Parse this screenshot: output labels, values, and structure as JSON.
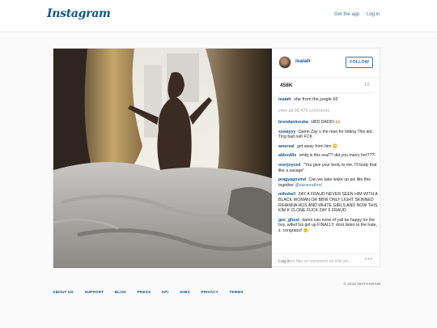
{
  "header": {
    "logo": "Instagram",
    "get_app": "Get the app",
    "login": "Log in"
  },
  "post": {
    "username": "isaiah",
    "follow_label": "FOLLOW",
    "likes": "458K",
    "age": "1d",
    "caption_user": "isaiah",
    "caption_text": "she from the jungle 66",
    "view_all": "view all 38,479 comments",
    "comments": [
      {
        "user": "brendaninoska",
        "text": "HBD DADDI 🙌🏼"
      },
      {
        "user": "sswayyy",
        "text": "Damn Zay u the man for hitting This kid.. Ting bad nah FCK"
      },
      {
        "user": "amereal",
        "text": "get away from him 😳"
      },
      {
        "user": "abbsville",
        "text": "omfg is this real?? did you marry her???!"
      },
      {
        "user": "overjoyced",
        "text": "\"You give your body to me, I'll body that like a savage\""
      },
      {
        "user": "pragyagovind",
        "text": "Can we take wake up pix like this together",
        "mention": "@aaranrathod"
      },
      {
        "user": "mihshell",
        "text": "ZAY A FRAUD NEVER SEEN HIM WITH A BLACK WOMAN OR BBW ONLY LIGHT SKINNED RIHANNA HOS AND WHITE GIRLS AND NOW THIS KIM K CLONE FUCK ZAY 6 FRAUD"
      },
      {
        "user": "gee_ghost",
        "text": "damn can none of yall be happy for the boy. wifed his girl up FINALLY. dont listen to the hate, z. congratzz! 🙂"
      }
    ],
    "add_comment_login": "Log in",
    "add_comment_rest": "to like or comment on this po...",
    "more": "•••"
  },
  "footer": {
    "links": [
      "ABOUT US",
      "SUPPORT",
      "BLOG",
      "PRESS",
      "API",
      "JOBS",
      "PRIVACY",
      "TERMS"
    ],
    "copyright": "© 2015 INSTAGRAM"
  },
  "colors": {
    "link": "#125688",
    "secondary_link": "#3f729b",
    "muted": "#a5a7aa"
  }
}
